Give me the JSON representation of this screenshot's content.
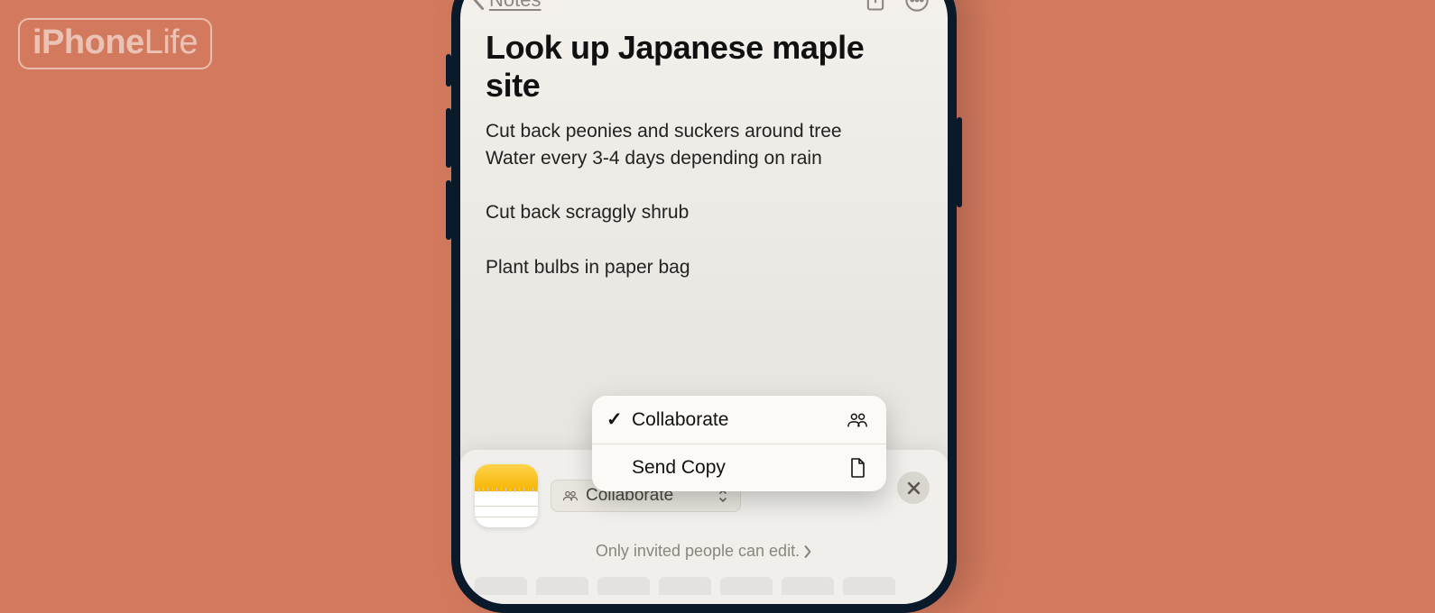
{
  "watermark": "iPhoneLife",
  "navbar": {
    "back_label": "Notes"
  },
  "note": {
    "title": "Look up Japanese maple site",
    "lines": [
      "Cut back peonies and suckers around tree",
      "Water every 3-4 days depending on rain",
      "",
      "Cut back scraggly shrub",
      "",
      "Plant bulbs in paper bag"
    ]
  },
  "popup": {
    "items": [
      {
        "label": "Collaborate",
        "checked": true,
        "icon": "people-icon"
      },
      {
        "label": "Send Copy",
        "checked": false,
        "icon": "document-icon"
      }
    ]
  },
  "share_sheet": {
    "mode_label": "Collaborate",
    "permission_text": "Only invited people can edit."
  }
}
